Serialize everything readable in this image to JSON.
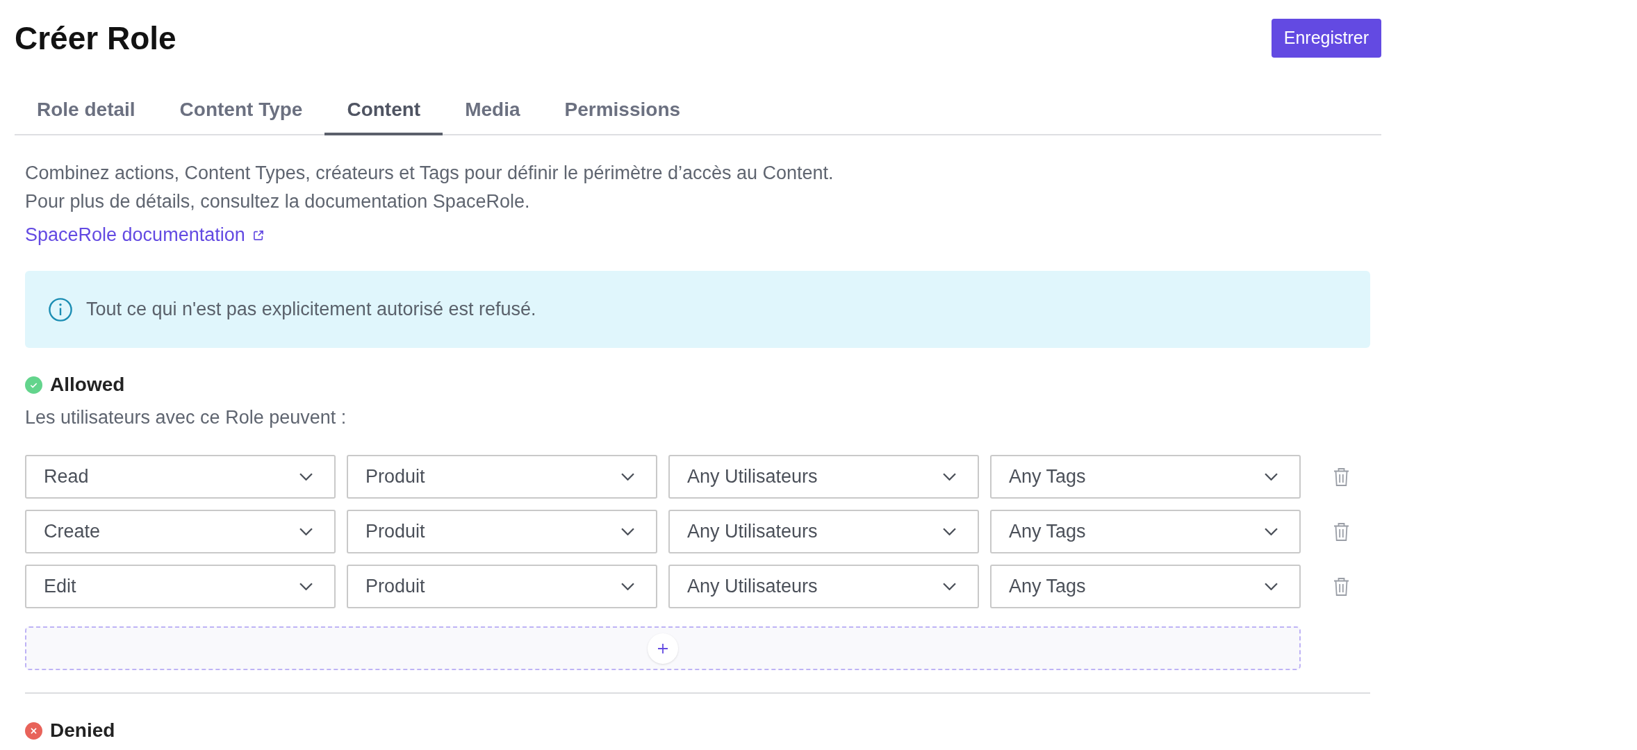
{
  "header": {
    "title": "Créer Role",
    "save_button": "Enregistrer"
  },
  "tabs": [
    {
      "label": "Role detail",
      "selected": false
    },
    {
      "label": "Content Type",
      "selected": false
    },
    {
      "label": "Content",
      "selected": true
    },
    {
      "label": "Media",
      "selected": false
    },
    {
      "label": "Permissions",
      "selected": false
    }
  ],
  "intro": {
    "lines": [
      "Combinez actions, Content Types, créateurs et Tags pour définir le périmètre d’accès au Content.",
      "Pour plus de détails, consultez la documentation SpaceRole."
    ],
    "link": "SpaceRole documentation"
  },
  "alert": {
    "text": "Tout ce qui n'est pas explicitement autorisé est refusé."
  },
  "sections": [
    {
      "kind": "allowed",
      "title": "Allowed",
      "subtitle": "Les utilisateurs avec ce Role peuvent :",
      "rules": [
        {
          "action": "Read",
          "content_type": "Produit",
          "users": "Any Utilisateurs",
          "tags": "Any Tags"
        },
        {
          "action": "Create",
          "content_type": "Produit",
          "users": "Any Utilisateurs",
          "tags": "Any Tags"
        },
        {
          "action": "Edit",
          "content_type": "Produit",
          "users": "Any Utilisateurs",
          "tags": "Any Tags"
        }
      ]
    },
    {
      "kind": "denied",
      "title": "Denied"
    }
  ]
}
